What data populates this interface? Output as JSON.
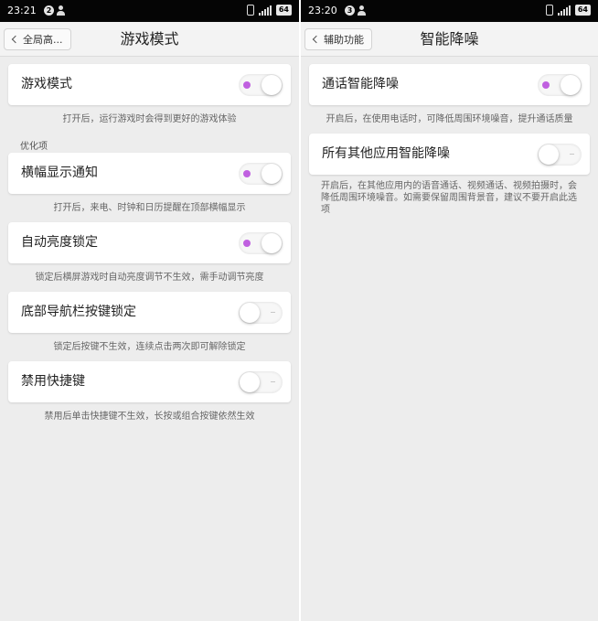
{
  "left": {
    "status_time": "23:21",
    "status_badge": "2",
    "battery": "64",
    "back_label": "全局高...",
    "title": "游戏模式",
    "section_label": "优化项",
    "items": [
      {
        "label": "游戏模式",
        "state": "on",
        "desc": "打开后，运行游戏时会得到更好的游戏体验"
      },
      {
        "label": "横幅显示通知",
        "state": "on",
        "desc": "打开后，来电、时钟和日历提醒在顶部横幅显示"
      },
      {
        "label": "自动亮度锁定",
        "state": "on",
        "desc": "锁定后横屏游戏时自动亮度调节不生效，需手动调节亮度"
      },
      {
        "label": "底部导航栏按键锁定",
        "state": "off",
        "desc": "锁定后按键不生效，连续点击两次即可解除锁定"
      },
      {
        "label": "禁用快捷键",
        "state": "off",
        "desc": "禁用后单击快捷键不生效，长按或组合按键依然生效"
      }
    ]
  },
  "right": {
    "status_time": "23:20",
    "status_badge": "3",
    "battery": "64",
    "back_label": "辅助功能",
    "title": "智能降噪",
    "items": [
      {
        "label": "通话智能降噪",
        "state": "on",
        "desc": "开启后，在使用电话时，可降低周围环境噪音，提升通话质量"
      },
      {
        "label": "所有其他应用智能降噪",
        "state": "off",
        "desc": "开启后，在其他应用内的语音通话、视频通话、视频拍摄时，会降低周围环境噪音。如需要保留周围背景音，建议不要开启此选项"
      }
    ]
  },
  "colors": {
    "toggle_on_indicator": "#c060e0",
    "statusbar": "#050505",
    "background": "#ededed"
  }
}
